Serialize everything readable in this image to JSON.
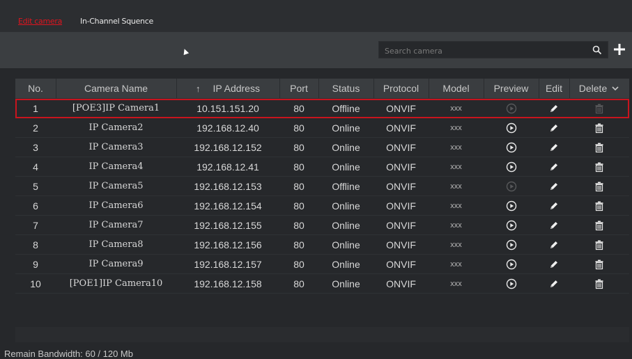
{
  "tabs": [
    {
      "label": "Edit camera",
      "active": true
    },
    {
      "label": "In-Channel Squence",
      "active": false
    }
  ],
  "search": {
    "placeholder": "Search camera"
  },
  "colors": {
    "accent": "#e0141e",
    "selected_outline": "#c8141e"
  },
  "table": {
    "headers": [
      "No.",
      "Camera Name",
      "IP Address",
      "Port",
      "Status",
      "Protocol",
      "Model",
      "Preview",
      "Edit",
      "Delete"
    ],
    "rows": [
      {
        "no": "1",
        "name": "[POE3]IP Camera1",
        "ip": "10.151.151.20",
        "port": "80",
        "status": "Offline",
        "protocol": "ONVIF",
        "model": "xxx",
        "selected": true,
        "preview_enabled": false,
        "delete_enabled": false
      },
      {
        "no": "2",
        "name": "IP Camera2",
        "ip": "192.168.12.40",
        "port": "80",
        "status": "Online",
        "protocol": "ONVIF",
        "model": "xxx",
        "selected": false,
        "preview_enabled": true,
        "delete_enabled": true
      },
      {
        "no": "3",
        "name": "IP Camera3",
        "ip": "192.168.12.152",
        "port": "80",
        "status": "Online",
        "protocol": "ONVIF",
        "model": "xxx",
        "selected": false,
        "preview_enabled": true,
        "delete_enabled": true
      },
      {
        "no": "4",
        "name": "IP Camera4",
        "ip": "192.168.12.41",
        "port": "80",
        "status": "Online",
        "protocol": "ONVIF",
        "model": "xxx",
        "selected": false,
        "preview_enabled": true,
        "delete_enabled": true
      },
      {
        "no": "5",
        "name": "IP Camera5",
        "ip": "192.168.12.153",
        "port": "80",
        "status": "Offline",
        "protocol": "ONVIF",
        "model": "xxx",
        "selected": false,
        "preview_enabled": false,
        "delete_enabled": true
      },
      {
        "no": "6",
        "name": "IP Camera6",
        "ip": "192.168.12.154",
        "port": "80",
        "status": "Online",
        "protocol": "ONVIF",
        "model": "xxx",
        "selected": false,
        "preview_enabled": true,
        "delete_enabled": true
      },
      {
        "no": "7",
        "name": "IP Camera7",
        "ip": "192.168.12.155",
        "port": "80",
        "status": "Online",
        "protocol": "ONVIF",
        "model": "xxx",
        "selected": false,
        "preview_enabled": true,
        "delete_enabled": true
      },
      {
        "no": "8",
        "name": "IP Camera8",
        "ip": "192.168.12.156",
        "port": "80",
        "status": "Online",
        "protocol": "ONVIF",
        "model": "xxx",
        "selected": false,
        "preview_enabled": true,
        "delete_enabled": true
      },
      {
        "no": "9",
        "name": "IP Camera9",
        "ip": "192.168.12.157",
        "port": "80",
        "status": "Online",
        "protocol": "ONVIF",
        "model": "xxx",
        "selected": false,
        "preview_enabled": true,
        "delete_enabled": true
      },
      {
        "no": "10",
        "name": "[POE1]IP Camera10",
        "ip": "192.168.12.158",
        "port": "80",
        "status": "Online",
        "protocol": "ONVIF",
        "model": "xxx",
        "selected": false,
        "preview_enabled": true,
        "delete_enabled": true
      }
    ]
  },
  "footer": {
    "remain_bandwidth": "Remain Bandwidth: 60 / 120 Mb"
  }
}
